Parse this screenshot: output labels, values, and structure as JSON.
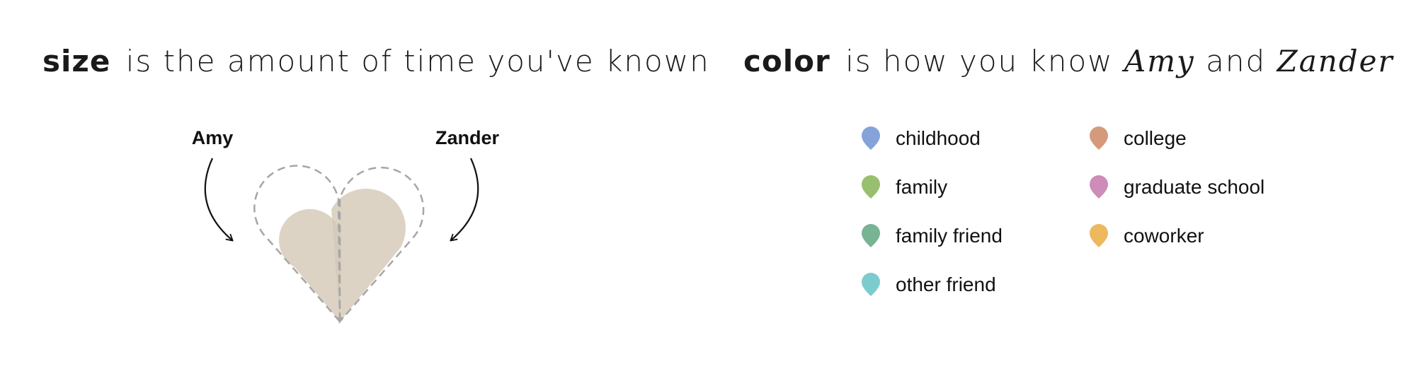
{
  "headings": {
    "size": {
      "keyword": "size",
      "rest": "is the amount of time you've known"
    },
    "color": {
      "keyword": "color",
      "rest_before": "is how you know",
      "name_a": "Amy",
      "conjunction": "and",
      "name_b": "Zander"
    }
  },
  "heart": {
    "left_label": "Amy",
    "right_label": "Zander",
    "fill_color": "#d4c8b6",
    "outline_color": "#a6a6a6",
    "arrow_color": "#111111"
  },
  "legend": {
    "columns": [
      [
        {
          "label": "childhood",
          "color": "#85a3d8",
          "icon": "teardrop-icon"
        },
        {
          "label": "family",
          "color": "#98bf6e",
          "icon": "teardrop-icon"
        },
        {
          "label": "family friend",
          "color": "#78b493",
          "icon": "teardrop-icon"
        },
        {
          "label": "other friend",
          "color": "#7ccccd",
          "icon": "teardrop-icon"
        }
      ],
      [
        {
          "label": "college",
          "color": "#d49a7b",
          "icon": "teardrop-icon"
        },
        {
          "label": "graduate school",
          "color": "#cd8db8",
          "icon": "teardrop-icon"
        },
        {
          "label": "coworker",
          "color": "#edb85e",
          "icon": "teardrop-icon"
        }
      ]
    ]
  }
}
